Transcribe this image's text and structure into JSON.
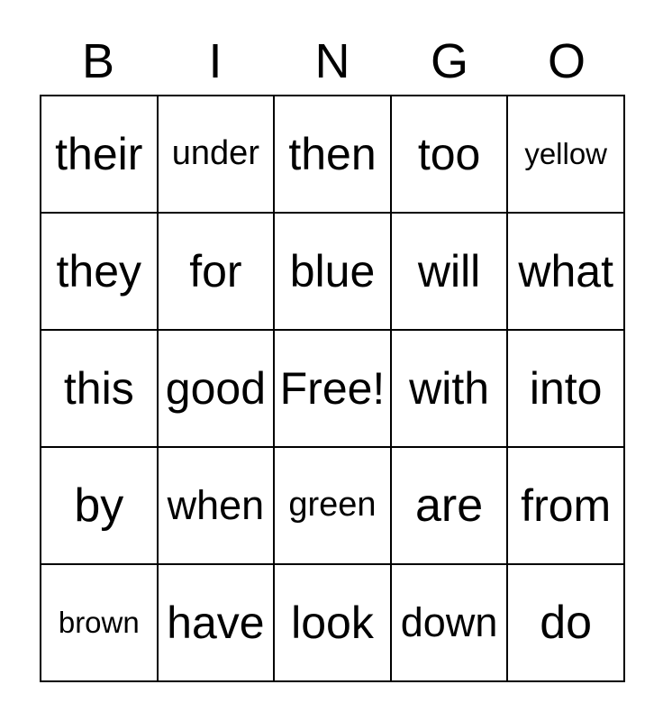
{
  "card": {
    "header_letters": [
      "B",
      "I",
      "N",
      "G",
      "O"
    ],
    "free_space_label": "Free!",
    "colors": {
      "background": "#ffffff",
      "cell_background": "#ffffff",
      "border": "#000000",
      "text": "#000000"
    },
    "grid": {
      "columns": 5,
      "rows": 5,
      "cells": [
        [
          {
            "word": "their",
            "size": "lg"
          },
          {
            "word": "under",
            "size": "sm"
          },
          {
            "word": "then",
            "size": "lg"
          },
          {
            "word": "too",
            "size": "lg"
          },
          {
            "word": "yellow",
            "size": "xs"
          }
        ],
        [
          {
            "word": "they",
            "size": "lg"
          },
          {
            "word": "for",
            "size": "lg"
          },
          {
            "word": "blue",
            "size": "lg"
          },
          {
            "word": "will",
            "size": "lg"
          },
          {
            "word": "what",
            "size": "lg"
          }
        ],
        [
          {
            "word": "this",
            "size": "lg"
          },
          {
            "word": "good",
            "size": "lg"
          },
          {
            "word": "Free!",
            "size": "lg"
          },
          {
            "word": "with",
            "size": "lg"
          },
          {
            "word": "into",
            "size": "lg"
          }
        ],
        [
          {
            "word": "by",
            "size": "xl"
          },
          {
            "word": "when",
            "size": "md"
          },
          {
            "word": "green",
            "size": "sm"
          },
          {
            "word": "are",
            "size": "xl"
          },
          {
            "word": "from",
            "size": "lg"
          }
        ],
        [
          {
            "word": "brown",
            "size": "xs"
          },
          {
            "word": "have",
            "size": "lg"
          },
          {
            "word": "look",
            "size": "lg"
          },
          {
            "word": "down",
            "size": "md"
          },
          {
            "word": "do",
            "size": "xl"
          }
        ]
      ]
    }
  }
}
